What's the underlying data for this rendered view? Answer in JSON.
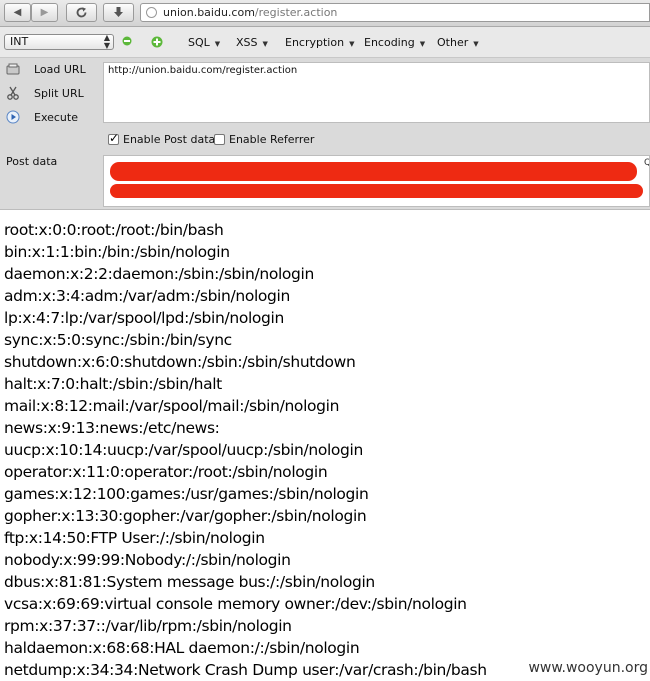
{
  "browser": {
    "url_host": "union.baidu.com",
    "url_path": "/register.action",
    "icons": [
      "back-icon",
      "forward-icon",
      "reload-icon",
      "download-icon",
      "globe-icon"
    ]
  },
  "toolbar": {
    "select_value": "INT",
    "menus": [
      "SQL",
      "XSS",
      "Encryption",
      "Encoding",
      "Other"
    ]
  },
  "actions": {
    "load": "Load URL",
    "split": "Split URL",
    "execute": "Execute"
  },
  "url_value": "http://union.baidu.com/register.action",
  "options": {
    "post": {
      "label": "Enable Post data",
      "checked": true
    },
    "referrer": {
      "label": "Enable Referrer",
      "checked": false
    }
  },
  "post": {
    "label": "Post data",
    "fragment": "Qj"
  },
  "output_lines": [
    "root:x:0:0:root:/root:/bin/bash",
    "bin:x:1:1:bin:/bin:/sbin/nologin",
    "daemon:x:2:2:daemon:/sbin:/sbin/nologin",
    "adm:x:3:4:adm:/var/adm:/sbin/nologin",
    "lp:x:4:7:lp:/var/spool/lpd:/sbin/nologin",
    "sync:x:5:0:sync:/sbin:/bin/sync",
    "shutdown:x:6:0:shutdown:/sbin:/sbin/shutdown",
    "halt:x:7:0:halt:/sbin:/sbin/halt",
    "mail:x:8:12:mail:/var/spool/mail:/sbin/nologin",
    "news:x:9:13:news:/etc/news:",
    "uucp:x:10:14:uucp:/var/spool/uucp:/sbin/nologin",
    "operator:x:11:0:operator:/root:/sbin/nologin",
    "games:x:12:100:games:/usr/games:/sbin/nologin",
    "gopher:x:13:30:gopher:/var/gopher:/sbin/nologin",
    "ftp:x:14:50:FTP User:/:/sbin/nologin",
    "nobody:x:99:99:Nobody:/:/sbin/nologin",
    "dbus:x:81:81:System message bus:/:/sbin/nologin",
    "vcsa:x:69:69:virtual console memory owner:/dev:/sbin/nologin",
    "rpm:x:37:37::/var/lib/rpm:/sbin/nologin",
    "haldaemon:x:68:68:HAL daemon:/:/sbin/nologin",
    "netdump:x:34:34:Network Crash Dump user:/var/crash:/bin/bash"
  ],
  "watermark": "www.wooyun.org",
  "colors": {
    "redaction": "#ee2a12",
    "panel": "#dadada"
  }
}
